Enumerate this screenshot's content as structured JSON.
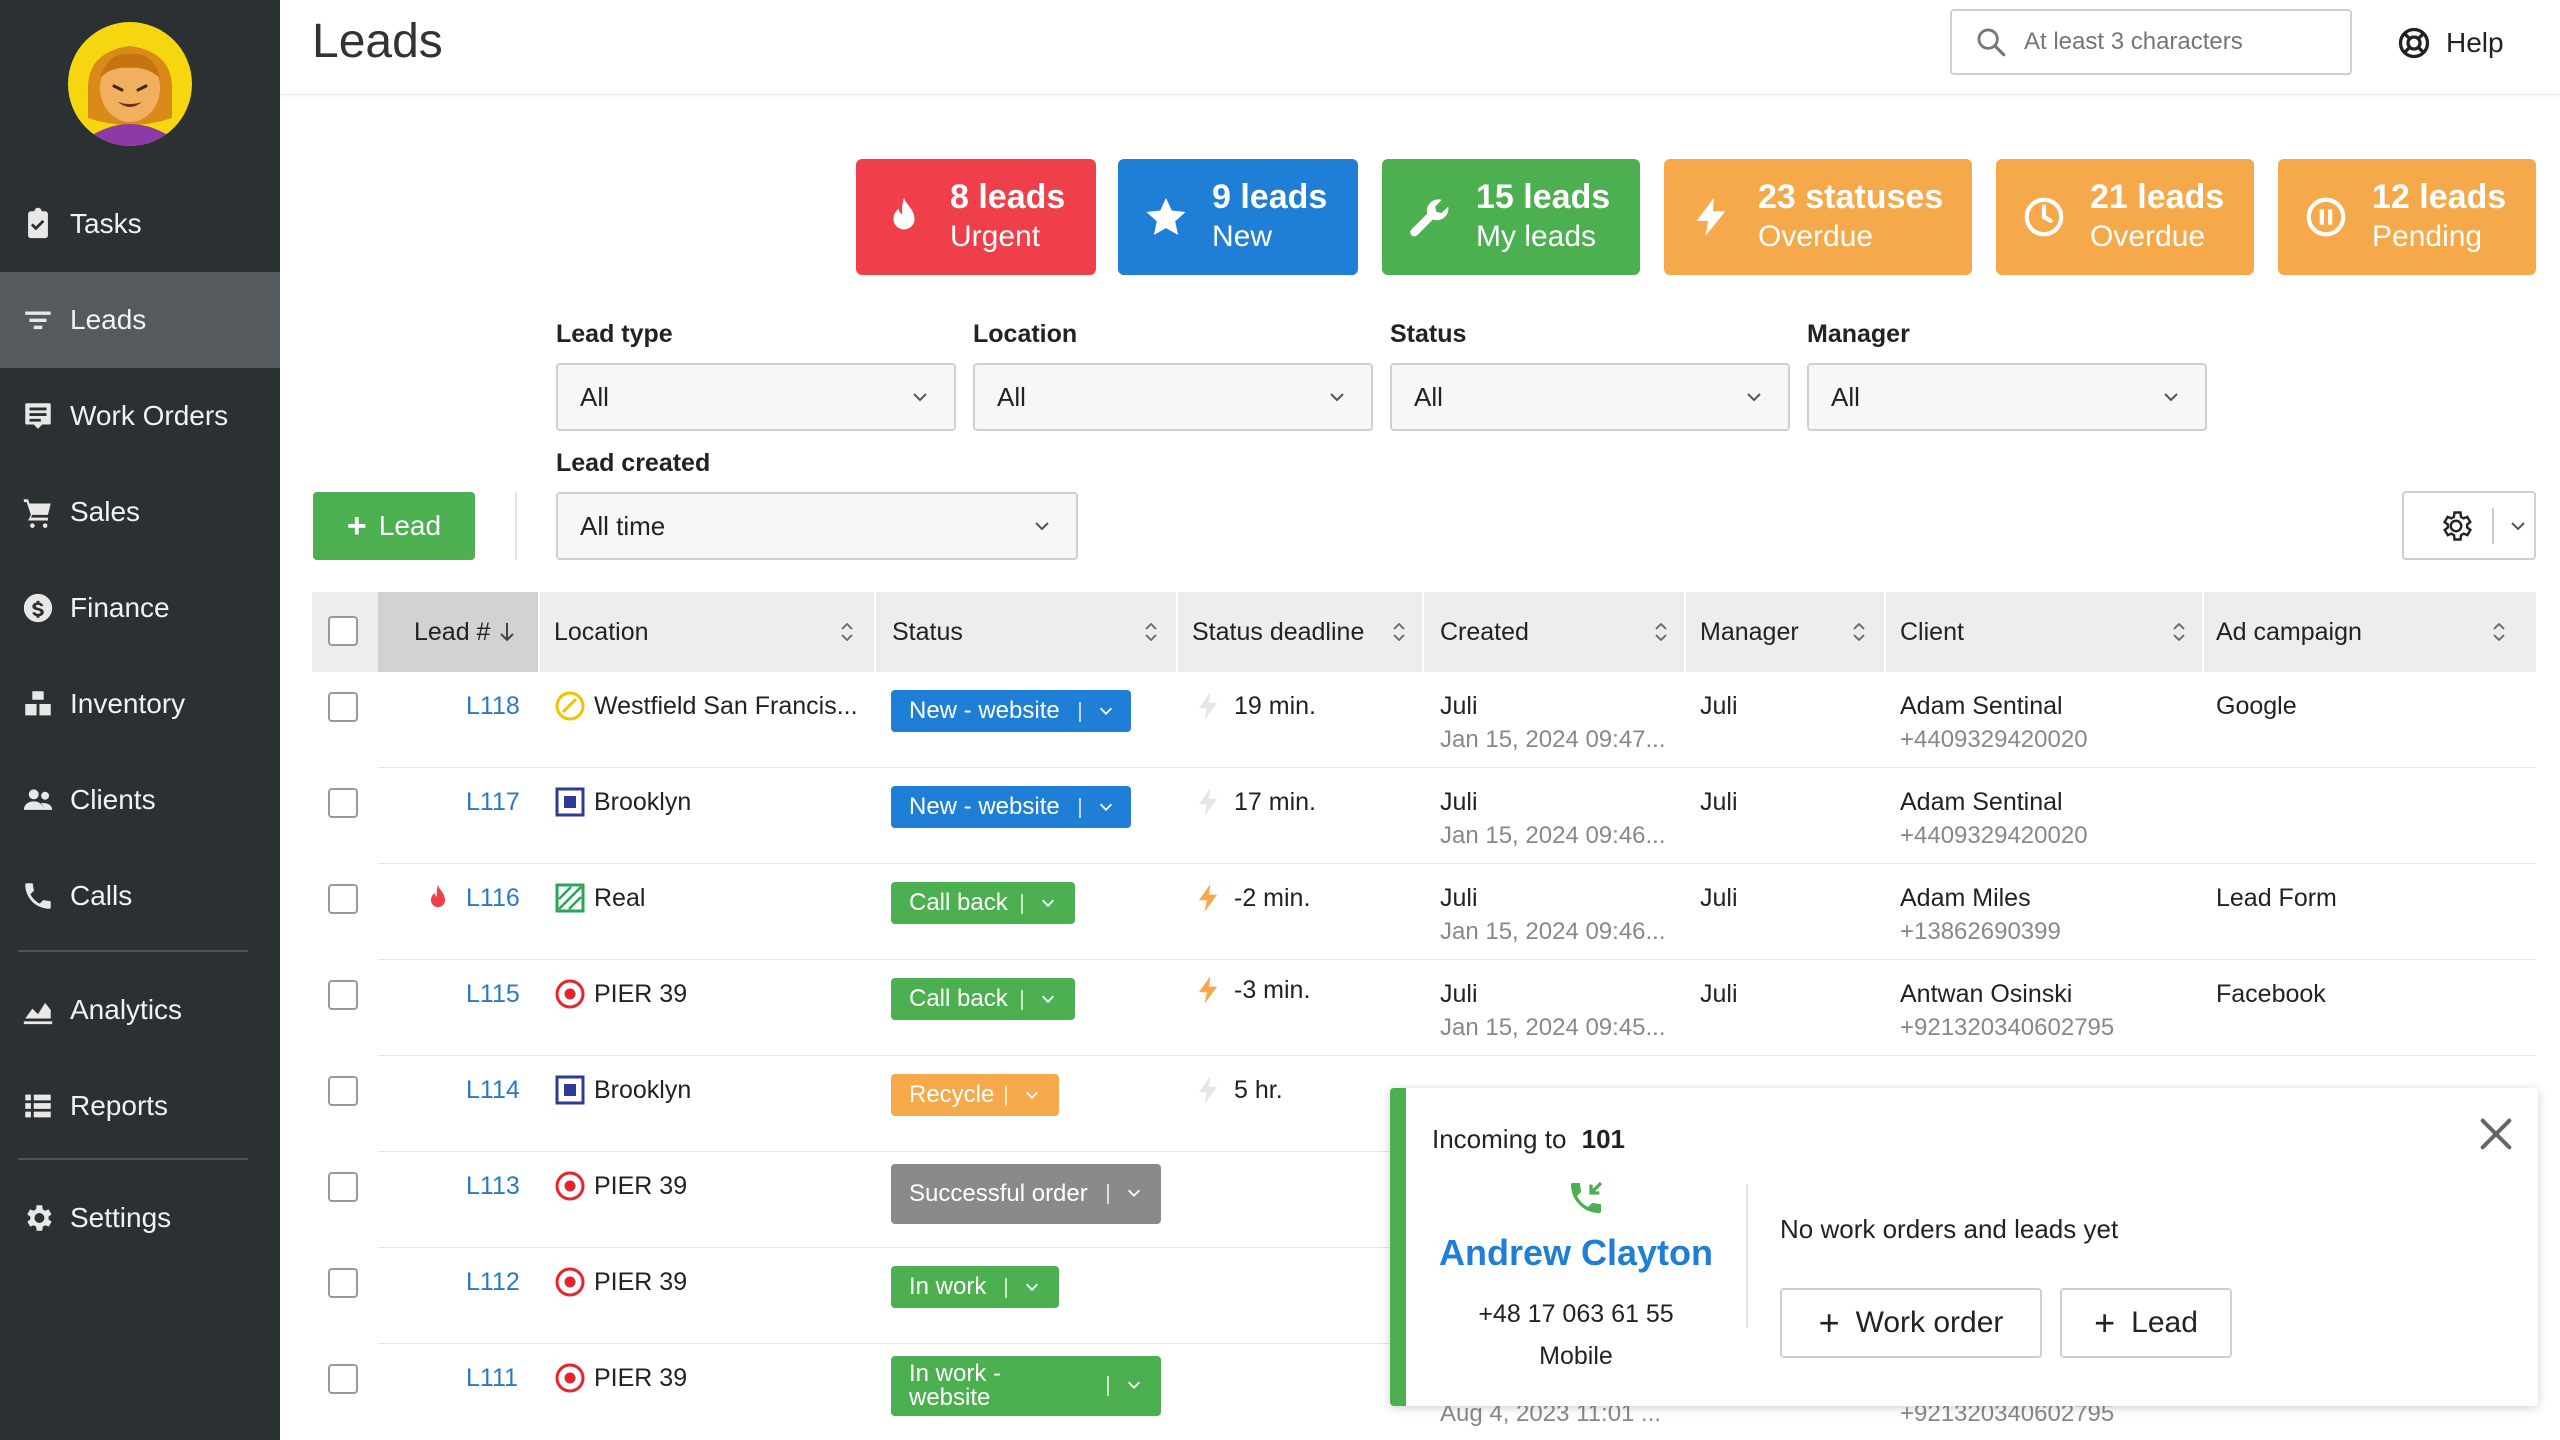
{
  "sidebar": {
    "items": [
      {
        "label": "Tasks",
        "icon": "clipboard-check-icon"
      },
      {
        "label": "Leads",
        "icon": "funnel-icon"
      },
      {
        "label": "Work Orders",
        "icon": "work-order-icon"
      },
      {
        "label": "Sales",
        "icon": "cart-icon"
      },
      {
        "label": "Finance",
        "icon": "dollar-icon"
      },
      {
        "label": "Inventory",
        "icon": "boxes-icon"
      },
      {
        "label": "Clients",
        "icon": "users-icon"
      },
      {
        "label": "Calls",
        "icon": "phone-icon"
      },
      {
        "label": "Analytics",
        "icon": "chart-area-icon"
      },
      {
        "label": "Reports",
        "icon": "list-icon"
      },
      {
        "label": "Settings",
        "icon": "gear-icon"
      }
    ],
    "active": "Leads"
  },
  "header": {
    "title": "Leads",
    "search_placeholder": "At least 3 characters",
    "help_label": "Help"
  },
  "cards": [
    {
      "count": "8 leads",
      "label": "Urgent",
      "color": "#ef3f4a",
      "icon": "flame-icon"
    },
    {
      "count": "9 leads",
      "label": "New",
      "color": "#1f7ed6",
      "icon": "star-icon"
    },
    {
      "count": "15 leads",
      "label": "My leads",
      "color": "#4caf50",
      "icon": "wrench-icon"
    },
    {
      "count": "23 statuses",
      "label": "Overdue",
      "color": "#f5a94a",
      "icon": "lightning-icon"
    },
    {
      "count": "21 leads",
      "label": "Overdue",
      "color": "#f5a94a",
      "icon": "clock-icon"
    },
    {
      "count": "12 leads",
      "label": "Pending",
      "color": "#f5a94a",
      "icon": "pause-icon"
    }
  ],
  "filters": {
    "lead_type": {
      "label": "Lead type",
      "value": "All"
    },
    "location": {
      "label": "Location",
      "value": "All"
    },
    "status": {
      "label": "Status",
      "value": "All"
    },
    "manager": {
      "label": "Manager",
      "value": "All"
    },
    "lead_created": {
      "label": "Lead created",
      "value": "All time"
    }
  },
  "toolbar": {
    "add_lead_label": "Lead"
  },
  "table": {
    "columns": [
      "Lead #",
      "Location",
      "Status",
      "Status deadline",
      "Created",
      "Manager",
      "Client",
      "Ad campaign"
    ],
    "rows": [
      {
        "id": "L118",
        "location": "Westfield San Francis...",
        "loc_icon": "tag-icon",
        "status": "New - website",
        "status_color": "#1f7ed6",
        "deadline": "19 min.",
        "deadline_color": "#e6e6e6",
        "created_by": "Juli",
        "created_at": "Jan 15, 2024 09:47...",
        "manager": "Juli",
        "client": "Adam Sentinal",
        "phone": "+4409329420020",
        "campaign": "Google",
        "urgent": false
      },
      {
        "id": "L117",
        "location": "Brooklyn",
        "loc_icon": "square-icon",
        "status": "New - website",
        "status_color": "#1f7ed6",
        "deadline": "17 min.",
        "deadline_color": "#e6e6e6",
        "created_by": "Juli",
        "created_at": "Jan 15, 2024 09:46...",
        "manager": "Juli",
        "client": "Adam Sentinal",
        "phone": "+4409329420020",
        "campaign": "",
        "urgent": false
      },
      {
        "id": "L116",
        "location": "Real",
        "loc_icon": "hatched-square-icon",
        "status": "Call back",
        "status_color": "#4caf50",
        "deadline": "-2 min.",
        "deadline_color": "#f5a94a",
        "created_by": "Juli",
        "created_at": "Jan 15, 2024 09:46...",
        "manager": "Juli",
        "client": "Adam Miles",
        "phone": "+13862690399",
        "campaign": "Lead Form",
        "urgent": true
      },
      {
        "id": "L115",
        "location": "PIER 39",
        "loc_icon": "target-icon",
        "status": "Call back",
        "status_color": "#4caf50",
        "deadline": "-3 min.",
        "deadline_color": "#f5a94a",
        "created_by": "Juli",
        "created_at": "Jan 15, 2024 09:45...",
        "manager": "Juli",
        "client": "Antwan Osinski",
        "phone": "+921320340602795",
        "campaign": "Facebook",
        "urgent": false
      },
      {
        "id": "L114",
        "location": "Brooklyn",
        "loc_icon": "square-icon",
        "status": "Recycle",
        "status_color": "#f5a94a",
        "deadline": "5 hr.",
        "deadline_color": "#e6e6e6"
      },
      {
        "id": "L113",
        "location": "PIER 39",
        "loc_icon": "target-icon",
        "status": "Successful order",
        "status_color": "#8a8a8a"
      },
      {
        "id": "L112",
        "location": "PIER 39",
        "loc_icon": "target-icon",
        "status": "In work",
        "status_color": "#4caf50"
      },
      {
        "id": "L111",
        "location": "PIER 39",
        "loc_icon": "target-icon",
        "status": "In work - website",
        "status_color": "#4caf50",
        "created_at": "Aug 4, 2023 11:01 ...",
        "phone": "+921320340602795"
      }
    ]
  },
  "call_popup": {
    "incoming_label": "Incoming to",
    "extension": "101",
    "caller_name": "Andrew Clayton",
    "caller_phone": "+48 17 063 61 55",
    "phone_type": "Mobile",
    "empty_text": "No work orders and leads yet",
    "work_order_label": "Work order",
    "lead_label": "Lead"
  }
}
